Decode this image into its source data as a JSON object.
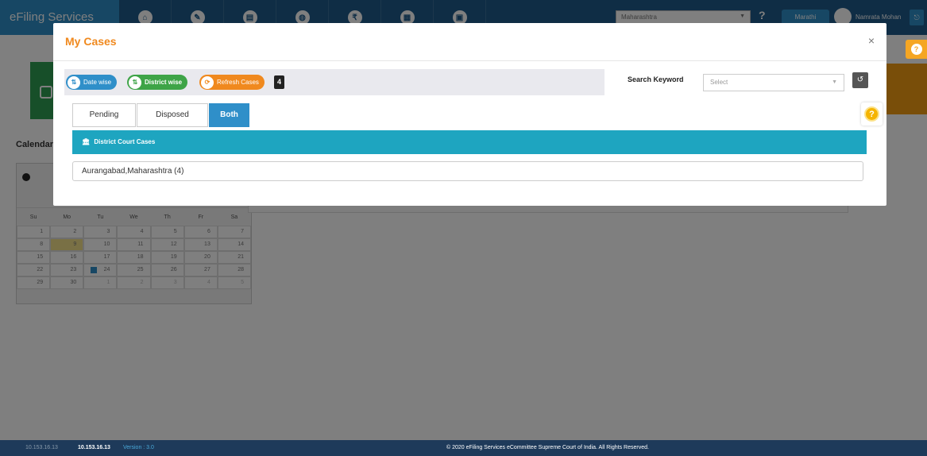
{
  "app": {
    "brand": "eFiling Services",
    "nav_icons": [
      "home-icon",
      "edit-icon",
      "document-icon",
      "globe-icon",
      "rupee-icon",
      "calendar-icon",
      "briefcase-icon"
    ],
    "state_select": "Maharashtra",
    "help": "?",
    "language": "Marathi",
    "user": "Namrata Mohan",
    "logout_glyph": "⎋"
  },
  "calendar": {
    "title": "Calendar",
    "days": [
      "Su",
      "Mo",
      "Tu",
      "We",
      "Th",
      "Fr",
      "Sa"
    ],
    "rows": [
      [
        "1",
        "2",
        "3",
        "4",
        "5",
        "6",
        "7"
      ],
      [
        "8",
        "9",
        "10",
        "11",
        "12",
        "13",
        "14"
      ],
      [
        "15",
        "16",
        "17",
        "18",
        "19",
        "20",
        "21"
      ],
      [
        "22",
        "23",
        "24",
        "25",
        "26",
        "27",
        "28"
      ],
      [
        "29",
        "30",
        "1",
        "2",
        "3",
        "4",
        "5"
      ]
    ]
  },
  "footer": {
    "ip_muted": "10.153.16.13",
    "ip": "10.153.16.13",
    "version": "Version : 3.0",
    "copyright": "© 2020 eFiling Services eCommittee Supreme Court of India. All Rights Reserved."
  },
  "modal": {
    "title": "My Cases",
    "close": "×",
    "toolbar": {
      "date_wise": "Date wise",
      "district_wise": "District wise",
      "refresh": "Refresh Cases",
      "count": "4",
      "search_label": "Search Keyword",
      "search_placeholder": "Select"
    },
    "tabs": [
      "Pending",
      "Disposed",
      "Both"
    ],
    "active_tab": "Both",
    "section_title": "District Court Cases",
    "courts": [
      "Aurangabad,Maharashtra (4)"
    ]
  },
  "colors": {
    "accent_blue": "#2f8fc9",
    "teal": "#1ea5c0",
    "orange": "#f0891e",
    "green": "#3ea447"
  }
}
